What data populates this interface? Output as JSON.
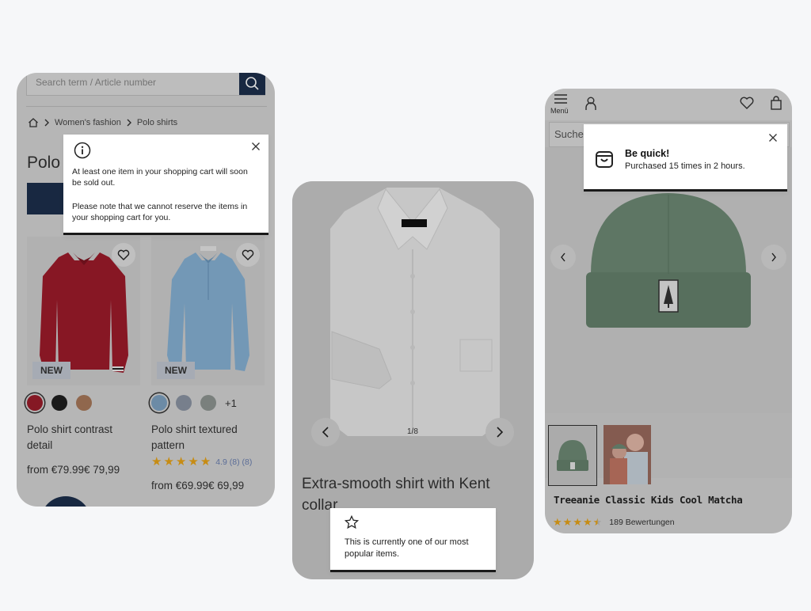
{
  "phone1": {
    "search_placeholder": "Search term / Article number",
    "breadcrumb": [
      "Women's fashion",
      "Polo shirts"
    ],
    "page_title": "Polo",
    "popup": {
      "text1": "At least one item in your shopping cart will soon be sold out.",
      "text2": "Please note that we cannot reserve the items in your shopping cart for you."
    },
    "products": [
      {
        "badge": "NEW",
        "name": "Polo shirt contrast detail",
        "price": "from €79.99€ 79,99",
        "swatches": [
          "#9b1c2a",
          "#1f1f1f",
          "#a8795a"
        ]
      },
      {
        "badge": "NEW",
        "name": "Polo shirt textured pattern",
        "price": "from €69.99€ 69,99",
        "swatches": [
          "#7ea2c2",
          "#8b94a3",
          "#8e9692"
        ],
        "more": "+1",
        "rating": 4.9,
        "rating_text": "4.9 (8) (8)"
      }
    ]
  },
  "phone2": {
    "counter": "1/8",
    "title": "Extra-smooth shirt with Kent collar",
    "popup_text": "This is currently one of our most popular items."
  },
  "phone3": {
    "menu_label": "Menü",
    "search_text": "Suche",
    "popup_title": "Be quick!",
    "popup_text": "Purchased 15 times in 2 hours.",
    "product_name": "Treeanie Classic Kids Cool Matcha",
    "rating": 4.5,
    "rating_count": "189 Bewertungen"
  },
  "colors": {
    "navy": "#1c2f4c",
    "star": "#e8a317",
    "beanie": "#6e8a75"
  }
}
